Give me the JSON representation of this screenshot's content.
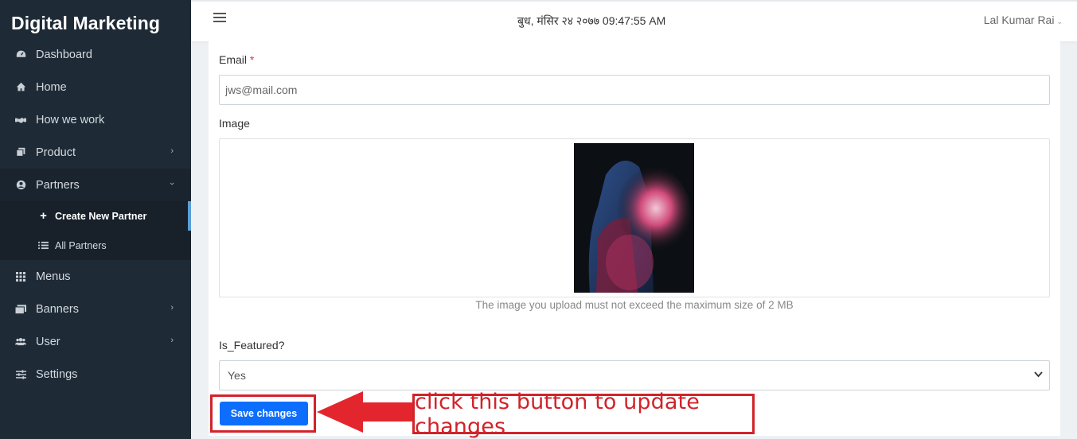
{
  "brand": "Digital Marketing",
  "nav": {
    "dashboard": "Dashboard",
    "home": "Home",
    "how_we_work": "How we work",
    "product": "Product",
    "partners": "Partners",
    "create_partner": "Create New Partner",
    "all_partners": "All Partners",
    "menus": "Menus",
    "banners": "Banners",
    "user": "User",
    "settings": "Settings"
  },
  "topbar": {
    "datetime": "बुध, मंसिर २४ २०७७ 09:47:55 AM",
    "user": "Lal Kumar Rai"
  },
  "form": {
    "email_label": "Email",
    "email_required": "*",
    "email_value": "jws@mail.com",
    "image_label": "Image",
    "image_help": "The image you upload must not exceed the maximum size of 2 MB",
    "featured_label": "Is_Featured?",
    "featured_value": "Yes",
    "save_label": "Save changes"
  },
  "annotation": {
    "callout": "click this button to update changes"
  },
  "colors": {
    "sidebar": "#1e2a35",
    "primary": "#0d6efd",
    "annotation": "#d2232a"
  }
}
